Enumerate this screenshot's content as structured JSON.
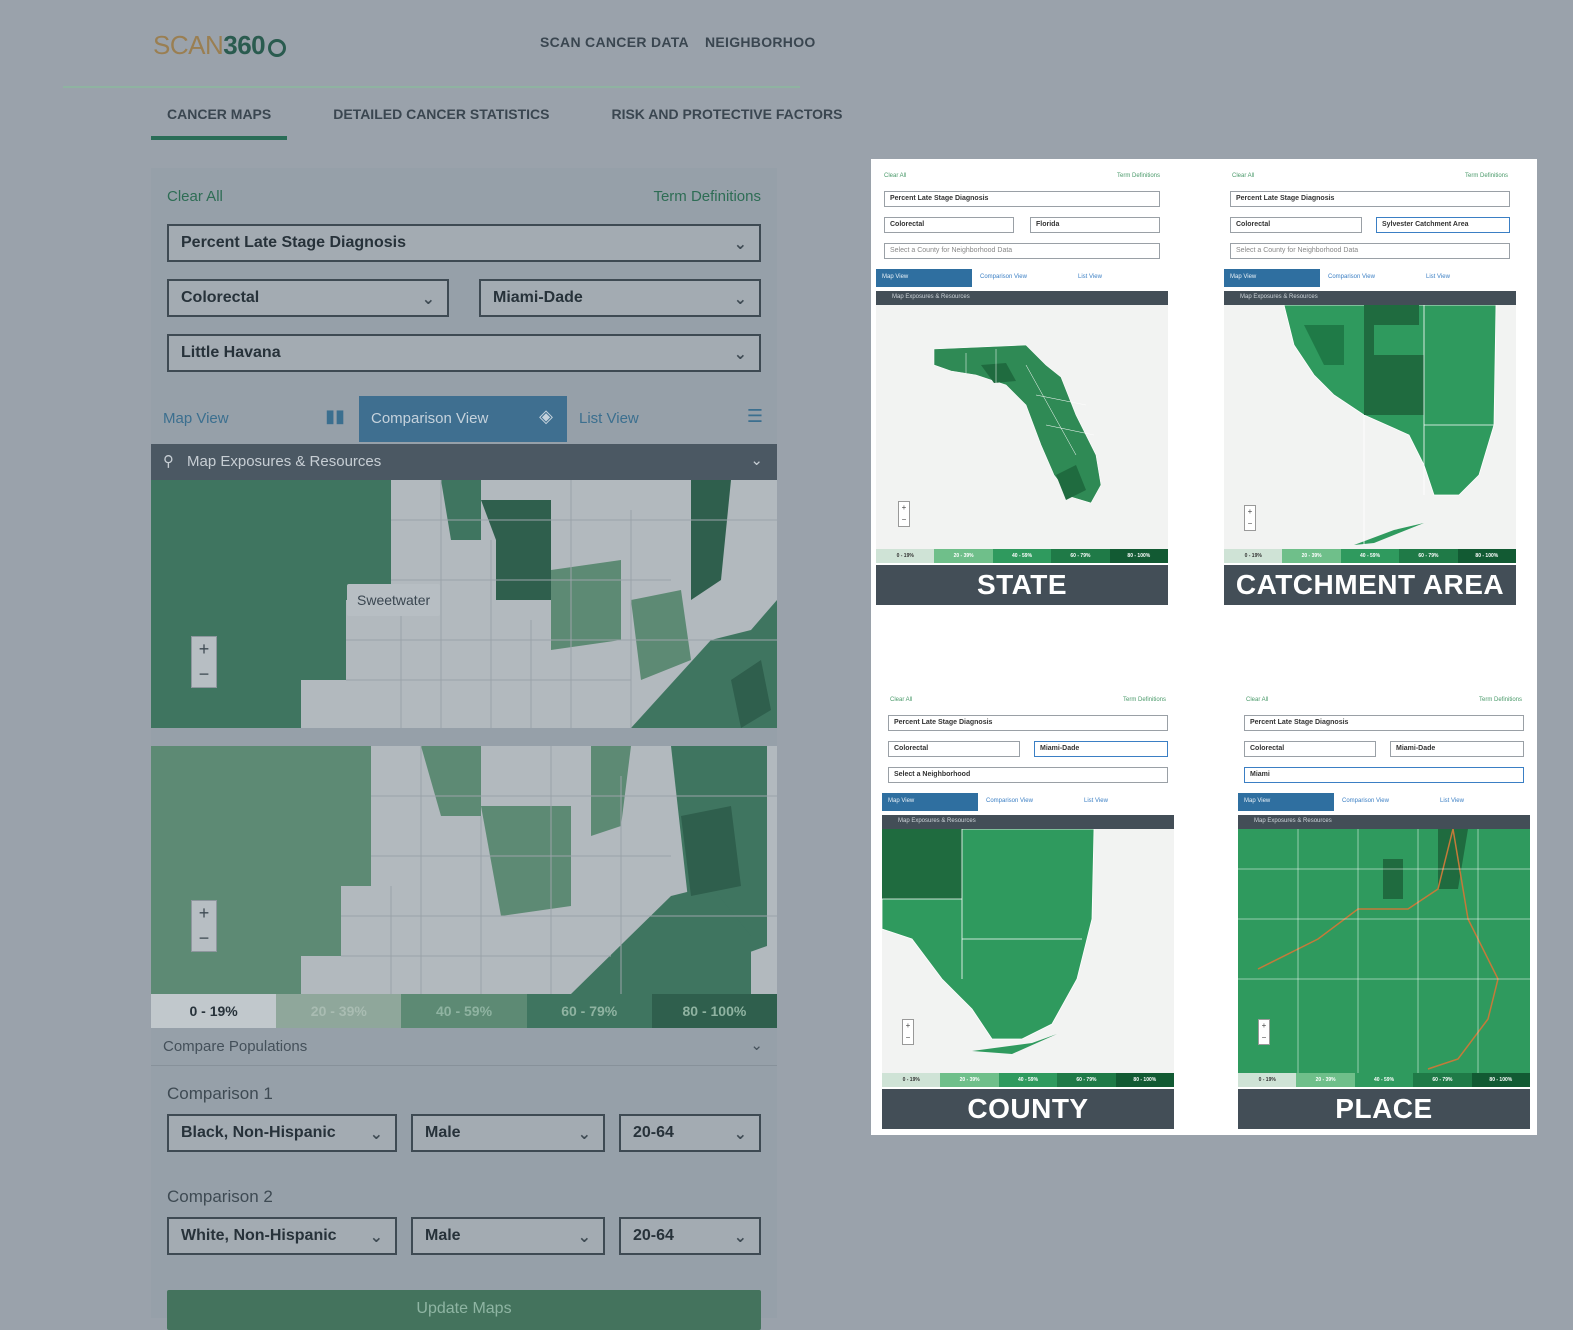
{
  "app": {
    "logo_scan": "SCAN",
    "logo_num": "360",
    "nav": [
      "SCAN CANCER DATA",
      "NEIGHBORHOO"
    ]
  },
  "subtabs": [
    "CANCER MAPS",
    "DETAILED CANCER STATISTICS",
    "RISK AND PROTECTIVE FACTORS"
  ],
  "filters": {
    "clear_all": "Clear All",
    "term_definitions": "Term Definitions",
    "measure": "Percent Late Stage Diagnosis",
    "cancer": "Colorectal",
    "county": "Miami-Dade",
    "neighborhood": "Little Havana"
  },
  "views": {
    "map": "Map View",
    "comparison": "Comparison View",
    "list": "List View",
    "exposures": "Map Exposures & Resources"
  },
  "map": {
    "tooltip": "Sweetwater",
    "zoom_in": "+",
    "zoom_out": "−"
  },
  "legend": [
    "0 - 19%",
    "20 - 39%",
    "40 - 59%",
    "60 - 79%",
    "80 - 100%"
  ],
  "legend_colors": [
    "#c1c8cc",
    "#8fa79b",
    "#5d8a74",
    "#3f7560",
    "#2f5f4d"
  ],
  "compare": {
    "header": "Compare Populations",
    "comparison1_label": "Comparison 1",
    "comparison1": {
      "race": "Black, Non-Hispanic",
      "sex": "Male",
      "age": "20-64"
    },
    "comparison2_label": "Comparison 2",
    "comparison2": {
      "race": "White, Non-Hispanic",
      "sex": "Male",
      "age": "20-64"
    },
    "update": "Update Maps"
  },
  "mockups": {
    "state": {
      "clear": "Clear All",
      "terms": "Term Definitions",
      "measure": "Percent Late Stage Diagnosis",
      "cancer": "Colorectal",
      "area": "Florida",
      "third": "Select a County for Neighborhood Data",
      "title": "STATE"
    },
    "catchment": {
      "clear": "Clear All",
      "terms": "Term Definitions",
      "measure": "Percent Late Stage Diagnosis",
      "cancer": "Colorectal",
      "area": "Sylvester Catchment Area",
      "third": "Select a County for Neighborhood Data",
      "title": "CATCHMENT AREA"
    },
    "county": {
      "clear": "Clear All",
      "terms": "Term Definitions",
      "measure": "Percent Late Stage Diagnosis",
      "cancer": "Colorectal",
      "area": "Miami-Dade",
      "third": "Select a Neighborhood",
      "title": "COUNTY"
    },
    "place": {
      "clear": "Clear All",
      "terms": "Term Definitions",
      "measure": "Percent Late Stage Diagnosis",
      "cancer": "Colorectal",
      "area": "Miami-Dade",
      "third": "Miami",
      "title": "PLACE"
    },
    "view_map": "Map View",
    "view_comp": "Comparison View",
    "view_list": "List View",
    "exposures": "Map Exposures & Resources",
    "legend": [
      "0 - 19%",
      "20 - 39%",
      "40 - 59%",
      "60 - 79%",
      "80 - 100%"
    ]
  }
}
